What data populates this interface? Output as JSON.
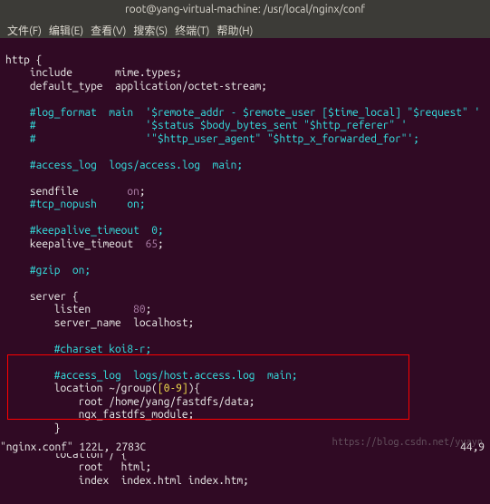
{
  "titlebar": "root@yang-virtual-machine: /usr/local/nginx/conf",
  "menu": {
    "file": "文件(F)",
    "edit": "编辑(E)",
    "view": "查看(V)",
    "search": "搜索(S)",
    "terminal": "终端(T)",
    "help": "帮助(H)"
  },
  "code": {
    "l1": "http {",
    "l2a": "    include       mime.types;",
    "l3a": "    default_type  application/octet-stream;",
    "l5": "    #log_format  main  '$remote_addr - $remote_user [$time_local] \"$request\" '",
    "l6": "    #                  '$status $body_bytes_sent \"$http_referer\" '",
    "l7": "    #                  '\"$http_user_agent\" \"$http_x_forwarded_for\"';",
    "l9": "    #access_log  logs/access.log  main;",
    "l11a": "    sendfile        ",
    "l11b": "on",
    "l11c": ";",
    "l12": "    #tcp_nopush     on;",
    "l14": "    #keepalive_timeout  0;",
    "l15a": "    keepalive_timeout  ",
    "l15b": "65",
    "l15c": ";",
    "l17": "    #gzip  on;",
    "l19": "    server {",
    "l20a": "        listen       ",
    "l20b": "80",
    "l20c": ";",
    "l21a": "        server_name  localhost;",
    "l23": "        #charset koi8-r;",
    "l25": "        #access_log  logs/host.access.log  main;",
    "l26a": "        location ~/group(",
    "l26b": "[0-9]",
    "l26c": "){",
    "l27a": "            root /home/yang/fastdfs/data;",
    "l28a": "            ngx_fastdfs_module;",
    "l29a": "        }",
    "l31a": "        location / {",
    "l32a": "            root   html;",
    "l33a": "            index  index.html index.htm;"
  },
  "fileinfo": "\"nginx.conf\" 122L, 2783C",
  "cursor_pos": "44,9",
  "watermark": "https://blog.csdn.net/yyayn"
}
